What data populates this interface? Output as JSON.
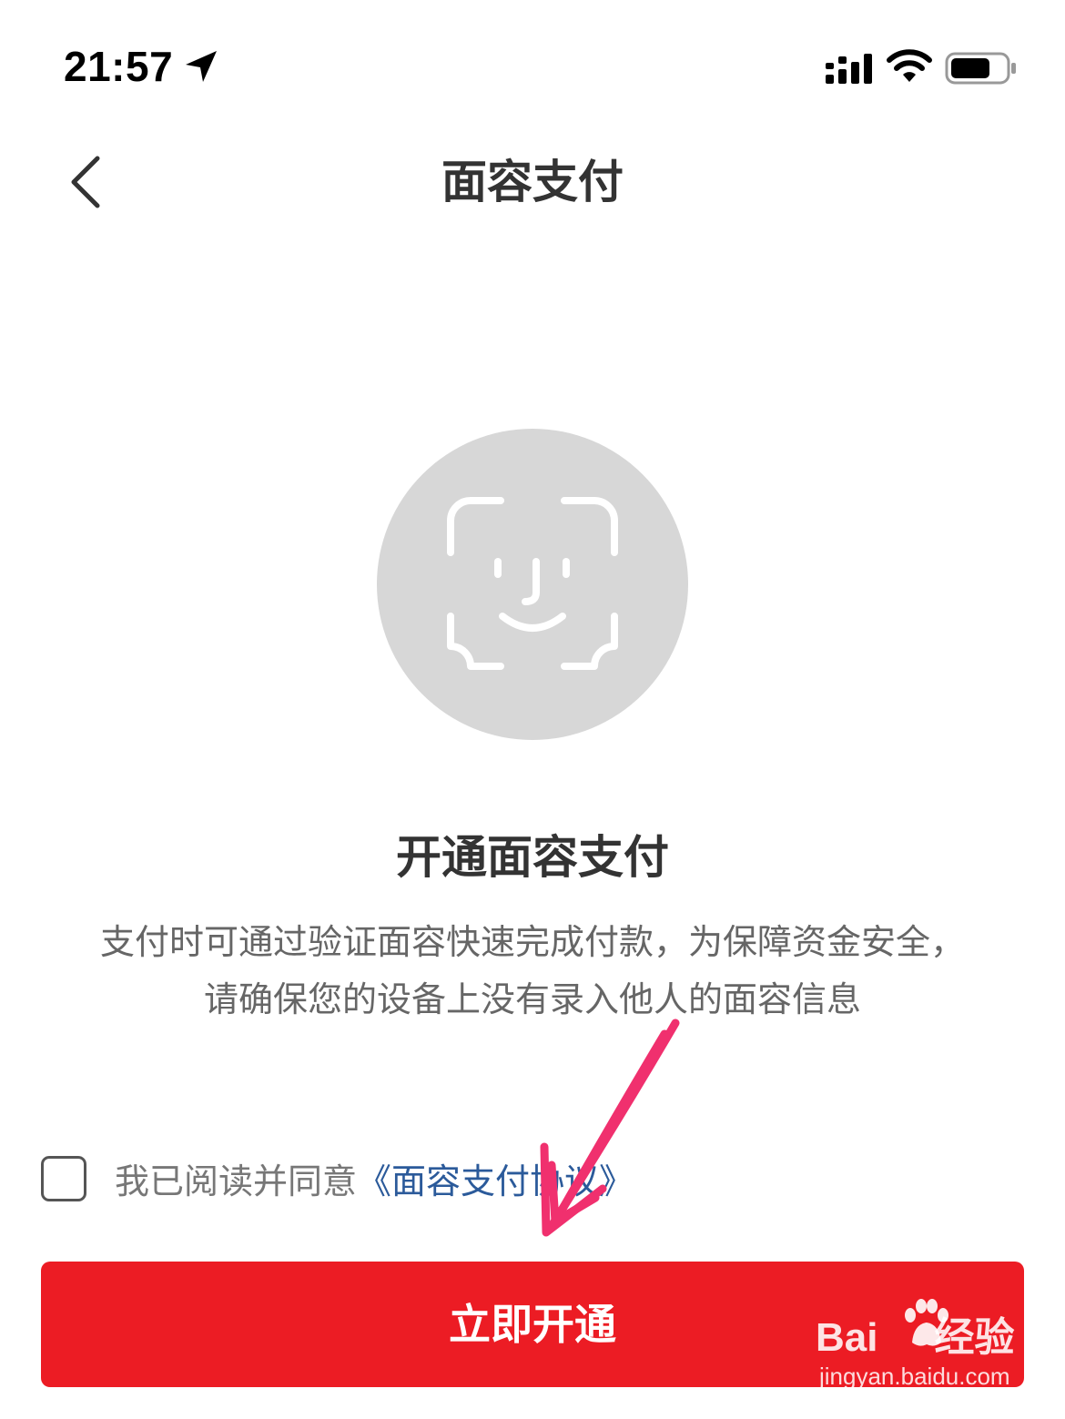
{
  "status_bar": {
    "time": "21:57",
    "icons": [
      "location-arrow-icon",
      "signal-icon",
      "wifi-icon",
      "battery-icon"
    ]
  },
  "nav": {
    "back_icon": "chevron-left-icon",
    "title": "面容支付"
  },
  "illustration": {
    "icon": "face-id-icon"
  },
  "content": {
    "heading": "开通面容支付",
    "description_line1": "支付时可通过验证面容快速完成付款，为保障资金安全，",
    "description_line2": "请确保您的设备上没有录入他人的面容信息"
  },
  "agreement": {
    "checked": false,
    "text": "我已阅读并同意",
    "link": "《面容支付协议》"
  },
  "button": {
    "label": "立即开通"
  },
  "watermark": {
    "logo_left": "Bai",
    "logo_right": "经验",
    "url": "jingyan.baidu.com"
  },
  "colors": {
    "primary": "#ec1c24",
    "link": "#2b5a9a",
    "annotation_arrow": "#f0306e",
    "illustration_bg": "#d7d7d7"
  }
}
